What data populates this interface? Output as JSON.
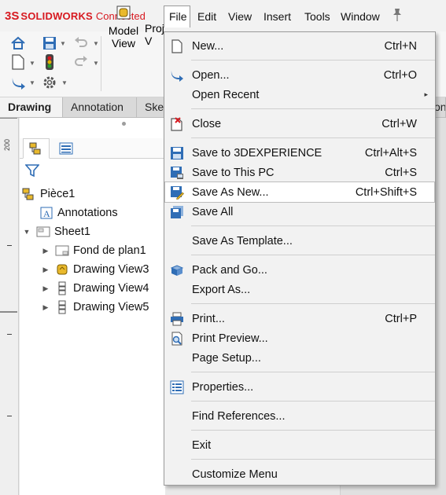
{
  "app": {
    "logo_mark": "3S",
    "brand": "SOLIDWORKS",
    "brand_suffix": "Connected"
  },
  "menubar": {
    "items": [
      "File",
      "Edit",
      "View",
      "Insert",
      "Tools",
      "Window"
    ]
  },
  "toolbar": {
    "model_view_line1": "Model",
    "model_view_line2": "View",
    "projected_view_line1": "Proj",
    "projected_view_line2": "V"
  },
  "command_tabs": [
    "Drawing",
    "Annotation",
    "Sketch",
    "on"
  ],
  "ruler": {
    "label": "200"
  },
  "feature_tree": {
    "root": "Pièce1",
    "items": [
      {
        "label": "Annotations",
        "indent": 1,
        "expander": ""
      },
      {
        "label": "Sheet1",
        "indent": 0,
        "expander": "▼"
      },
      {
        "label": "Fond de plan1",
        "indent": 1,
        "expander": "▶"
      },
      {
        "label": "Drawing View3",
        "indent": 1,
        "expander": "▶"
      },
      {
        "label": "Drawing View4",
        "indent": 1,
        "expander": "▶"
      },
      {
        "label": "Drawing View5",
        "indent": 1,
        "expander": "▶"
      }
    ]
  },
  "file_menu": {
    "items": [
      {
        "label": "New...",
        "shortcut": "Ctrl+N",
        "icon": "new-document-icon"
      },
      {
        "label": "Open...",
        "shortcut": "Ctrl+O",
        "icon": "open-arrow-icon"
      },
      {
        "label": "Open Recent",
        "shortcut": "",
        "icon": "",
        "submenu": "▸"
      },
      {
        "label": "Close",
        "shortcut": "Ctrl+W",
        "icon": "close-document-icon"
      },
      {
        "label": "Save to 3DEXPERIENCE",
        "shortcut": "Ctrl+Alt+S",
        "icon": "save-3dexperience-icon"
      },
      {
        "label": "Save to This PC",
        "shortcut": "Ctrl+S",
        "icon": "save-pc-icon"
      },
      {
        "label": "Save As New...",
        "shortcut": "Ctrl+Shift+S",
        "icon": "save-as-new-icon"
      },
      {
        "label": "Save All",
        "shortcut": "",
        "icon": "save-all-icon"
      },
      {
        "label": "Save As Template...",
        "shortcut": "",
        "icon": ""
      },
      {
        "label": "Pack and Go...",
        "shortcut": "",
        "icon": "pack-and-go-icon"
      },
      {
        "label": "Export As...",
        "shortcut": "",
        "icon": ""
      },
      {
        "label": "Print...",
        "shortcut": "Ctrl+P",
        "icon": "printer-icon"
      },
      {
        "label": "Print Preview...",
        "shortcut": "",
        "icon": "print-preview-icon"
      },
      {
        "label": "Page Setup...",
        "shortcut": "",
        "icon": ""
      },
      {
        "label": "Properties...",
        "shortcut": "",
        "icon": "properties-icon"
      },
      {
        "label": "Find References...",
        "shortcut": "",
        "icon": ""
      },
      {
        "label": "Exit",
        "shortcut": "",
        "icon": ""
      },
      {
        "label": "Customize Menu",
        "shortcut": "",
        "icon": ""
      }
    ],
    "highlighted": "Save As New..."
  },
  "colors": {
    "brand_red": "#d71920",
    "menu_bg": "#f2f2f2",
    "highlight_bg": "#ffffff",
    "icon_blue": "#2f6db5"
  }
}
